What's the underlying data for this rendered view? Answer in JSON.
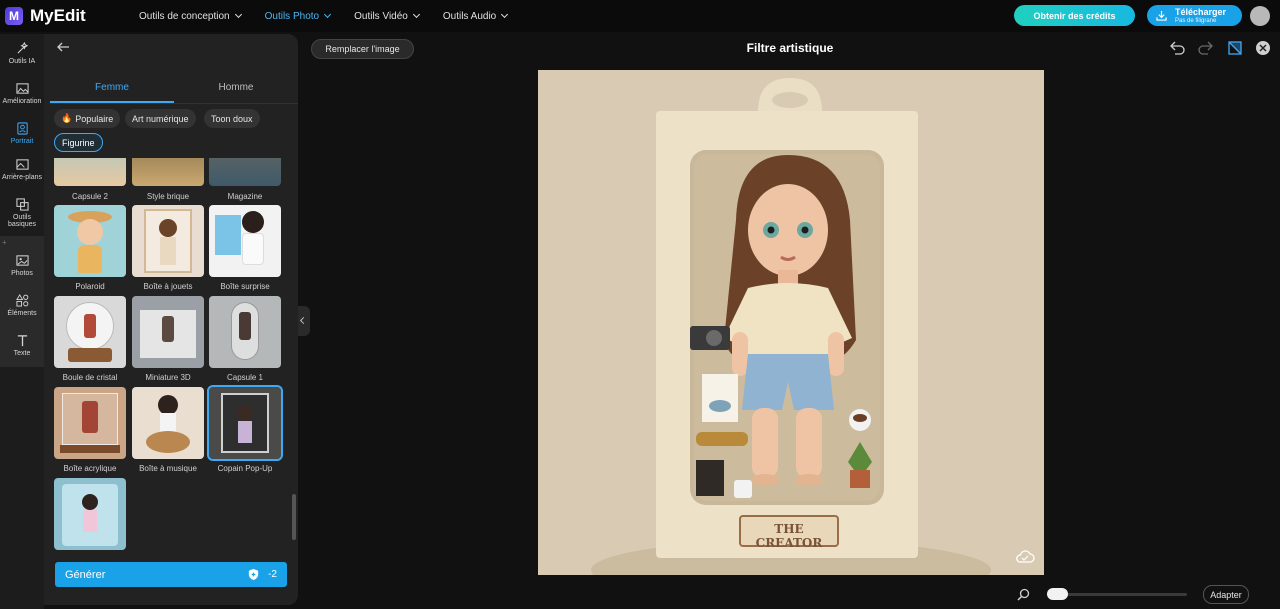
{
  "app": {
    "name": "MyEdit"
  },
  "topnav": [
    {
      "label": "Outils de conception",
      "active": false
    },
    {
      "label": "Outils Photo",
      "active": true
    },
    {
      "label": "Outils Vidéo",
      "active": false
    },
    {
      "label": "Outils Audio",
      "active": false
    }
  ],
  "header": {
    "credits_label": "Obtenir des crédits",
    "download_label": "Télécharger",
    "download_sub": "Pas de filigrane"
  },
  "rail": [
    {
      "label": "Outils IA",
      "icon": "magic-wand-icon",
      "active": false
    },
    {
      "label": "Amélioration",
      "icon": "image-enhance-icon",
      "active": false
    },
    {
      "label": "Portrait",
      "icon": "portrait-icon",
      "active": true
    },
    {
      "label": "Arrière-plans",
      "icon": "background-icon",
      "active": false
    },
    {
      "label": "Outils basiques",
      "icon": "basic-tools-icon",
      "active": false
    },
    {
      "label": "Photos",
      "icon": "photos-icon",
      "active": false
    },
    {
      "label": "Éléments",
      "icon": "elements-icon",
      "active": false
    },
    {
      "label": "Texte",
      "icon": "text-icon",
      "active": false
    }
  ],
  "panel": {
    "tabs": [
      {
        "label": "Femme",
        "active": true
      },
      {
        "label": "Homme",
        "active": false
      }
    ],
    "chips": [
      {
        "label": "Populaire",
        "icon": "fire-icon",
        "selected": false
      },
      {
        "label": "Art numérique",
        "selected": false
      },
      {
        "label": "Toon doux",
        "selected": false
      },
      {
        "label": "Figurine",
        "selected": true
      }
    ],
    "styles": [
      {
        "label": "Capsule 2",
        "selected": false
      },
      {
        "label": "Style brique",
        "selected": false
      },
      {
        "label": "Magazine",
        "selected": false
      },
      {
        "label": "Polaroid",
        "selected": false
      },
      {
        "label": "Boîte à jouets",
        "selected": false
      },
      {
        "label": "Boîte surprise",
        "selected": false
      },
      {
        "label": "Boule de cristal",
        "selected": false
      },
      {
        "label": "Miniature 3D",
        "selected": false
      },
      {
        "label": "Capsule 1",
        "selected": false
      },
      {
        "label": "Boîte acrylique",
        "selected": false
      },
      {
        "label": "Boîte à musique",
        "selected": false
      },
      {
        "label": "Copain Pop-Up",
        "selected": true
      },
      {
        "label": "",
        "selected": false
      }
    ],
    "generate_label": "Générer",
    "generate_cost": "-2"
  },
  "canvas": {
    "replace_label": "Remplacer l'image",
    "title": "Filtre artistique",
    "box_label": "THE CREATOR",
    "fit_label": "Adapter",
    "zoom_level": 0
  },
  "colors": {
    "accent": "#3fa9f5",
    "credits": "#1fd0c0",
    "download": "#1aa2e8"
  }
}
